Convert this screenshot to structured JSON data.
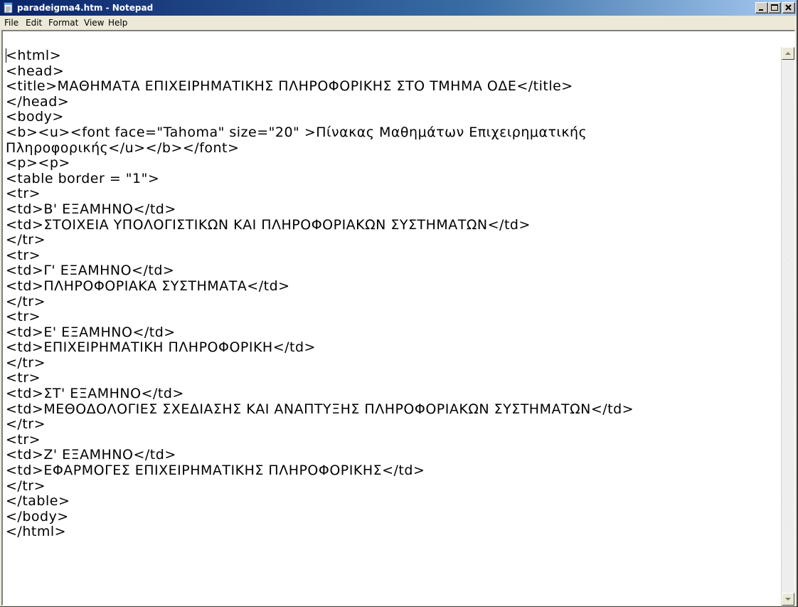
{
  "window": {
    "title": "paradeigma4.htm - Notepad"
  },
  "menu": {
    "file": "File",
    "edit": "Edit",
    "format": "Format",
    "view": "View",
    "help": "Help"
  },
  "icons": {
    "app": "notepad-icon",
    "minimize": "minimize-icon",
    "maximize": "maximize-icon",
    "close": "close-icon",
    "scroll_up": "scroll-up-arrow-icon",
    "scroll_down": "scroll-down-arrow-icon"
  },
  "editor": {
    "lines": [
      "<html>",
      "<head>",
      "<title>ΜΑΘΗΜΑΤΑ ΕΠΙΧΕΙΡΗΜΑΤΙΚΗΣ ΠΛΗΡΟΦΟΡΙΚΗΣ ΣΤΟ ΤΜΗΜΑ ΟΔΕ</title>",
      "</head>",
      "<body>",
      "<b><u><font face=\"Tahoma\" size=\"20\" >Πίνακας Μαθημάτων Επιχειρηματικής",
      "Πληροφορικής</u></b></font>",
      "<p><p>",
      "<table border = \"1\">",
      "<tr>",
      "<td>Β' ΕΞΑΜΗΝΟ</td>",
      "<td>ΣΤΟΙΧΕΙΑ ΥΠΟΛΟΓΙΣΤΙΚΩΝ ΚΑΙ ΠΛΗΡΟΦΟΡΙΑΚΩΝ ΣΥΣΤΗΜΑΤΩΝ</td>",
      "</tr>",
      "<tr>",
      "<td>Γ' ΕΞΑΜΗΝΟ</td>",
      "<td>ΠΛΗΡΟΦΟΡΙΑΚΑ ΣΥΣΤΗΜΑΤΑ</td>",
      "</tr>",
      "<tr>",
      "<td>Ε' ΕΞΑΜΗΝΟ</td>",
      "<td>ΕΠΙΧΕΙΡΗΜΑΤΙΚΗ ΠΛΗΡΟΦΟΡΙΚΗ</td>",
      "</tr>",
      "<tr>",
      "<td>ΣΤ' ΕΞΑΜΗΝΟ</td>",
      "<td>ΜΕΘΟΔΟΛΟΓΙΕΣ ΣΧΕΔΙΑΣΗΣ ΚΑΙ ΑΝΑΠΤΥΞΗΣ ΠΛΗΡΟΦΟΡΙΑΚΩΝ ΣΥΣΤΗΜΑΤΩΝ</td>",
      "</tr>",
      "<tr>",
      "<td>Ζ' ΕΞΑΜΗΝΟ</td>",
      "<td>ΕΦΑΡΜΟΓΕΣ ΕΠΙΧΕΙΡΗΜΑΤΙΚΗΣ ΠΛΗΡΟΦΟΡΙΚΗΣ</td>",
      "</tr>",
      "</table>",
      "</body>",
      "</html>"
    ]
  },
  "colors": {
    "titlebar_start": "#0a246a",
    "titlebar_end": "#a6caf0",
    "window_face": "#ece9d8",
    "editor_bg": "#ffffff"
  }
}
